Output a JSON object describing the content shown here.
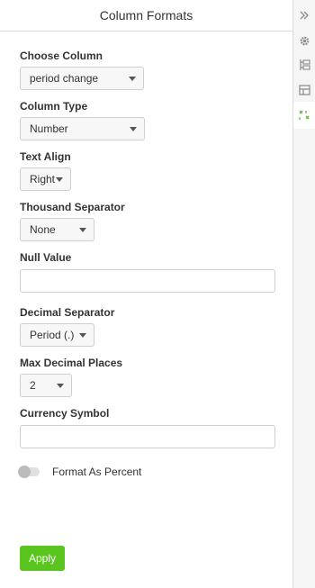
{
  "panel": {
    "title": "Column Formats",
    "choose_column": {
      "label": "Choose Column",
      "value": "period change"
    },
    "column_type": {
      "label": "Column Type",
      "value": "Number"
    },
    "text_align": {
      "label": "Text Align",
      "value": "Right"
    },
    "thousand_separator": {
      "label": "Thousand Separator",
      "value": "None"
    },
    "null_value": {
      "label": "Null Value",
      "value": ""
    },
    "decimal_separator": {
      "label": "Decimal Separator",
      "value": "Period (.)"
    },
    "max_decimal_places": {
      "label": "Max Decimal Places",
      "value": "2"
    },
    "currency_symbol": {
      "label": "Currency Symbol",
      "value": ""
    },
    "format_as_percent": {
      "label": "Format As Percent",
      "enabled": false
    },
    "apply_label": "Apply"
  },
  "rail": {
    "icons": [
      "double-chevron-right-icon",
      "gear-icon",
      "column-tree-icon",
      "layout-panel-icon",
      "column-format-icon"
    ],
    "active_icon": "column-format-icon",
    "accent_color": "#5bc51f"
  }
}
